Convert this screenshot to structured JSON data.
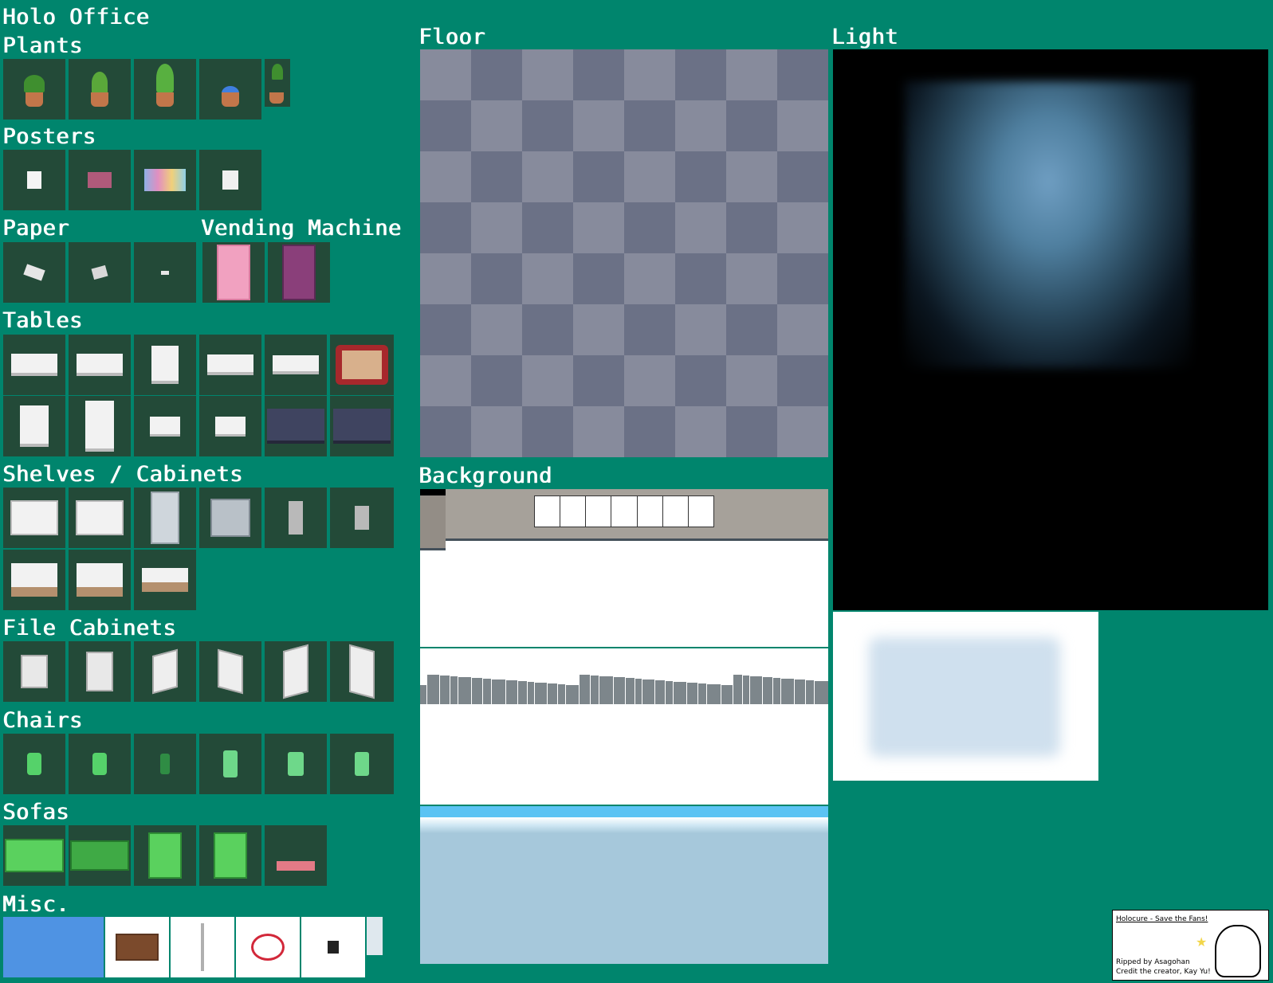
{
  "title": "Holo Office",
  "sections": {
    "plants": "Plants",
    "posters": "Posters",
    "paper": "Paper",
    "vending": "Vending Machine",
    "tables": "Tables",
    "shelves": "Shelves / Cabinets",
    "file_cabinets": "File Cabinets",
    "chairs": "Chairs",
    "sofas": "Sofas",
    "misc": "Misc.",
    "floor": "Floor",
    "background": "Background",
    "light": "Light"
  },
  "credit": {
    "game": "Holocure - Save the Fans!",
    "ripper": "Ripped by Asagohan",
    "creator": "Credit the creator, Kay Yu!"
  },
  "colors": {
    "sheet_bg": "#00856d",
    "tile_bg": "#234a38",
    "floor_light": "#878b9c",
    "floor_dark": "#6b7186"
  }
}
